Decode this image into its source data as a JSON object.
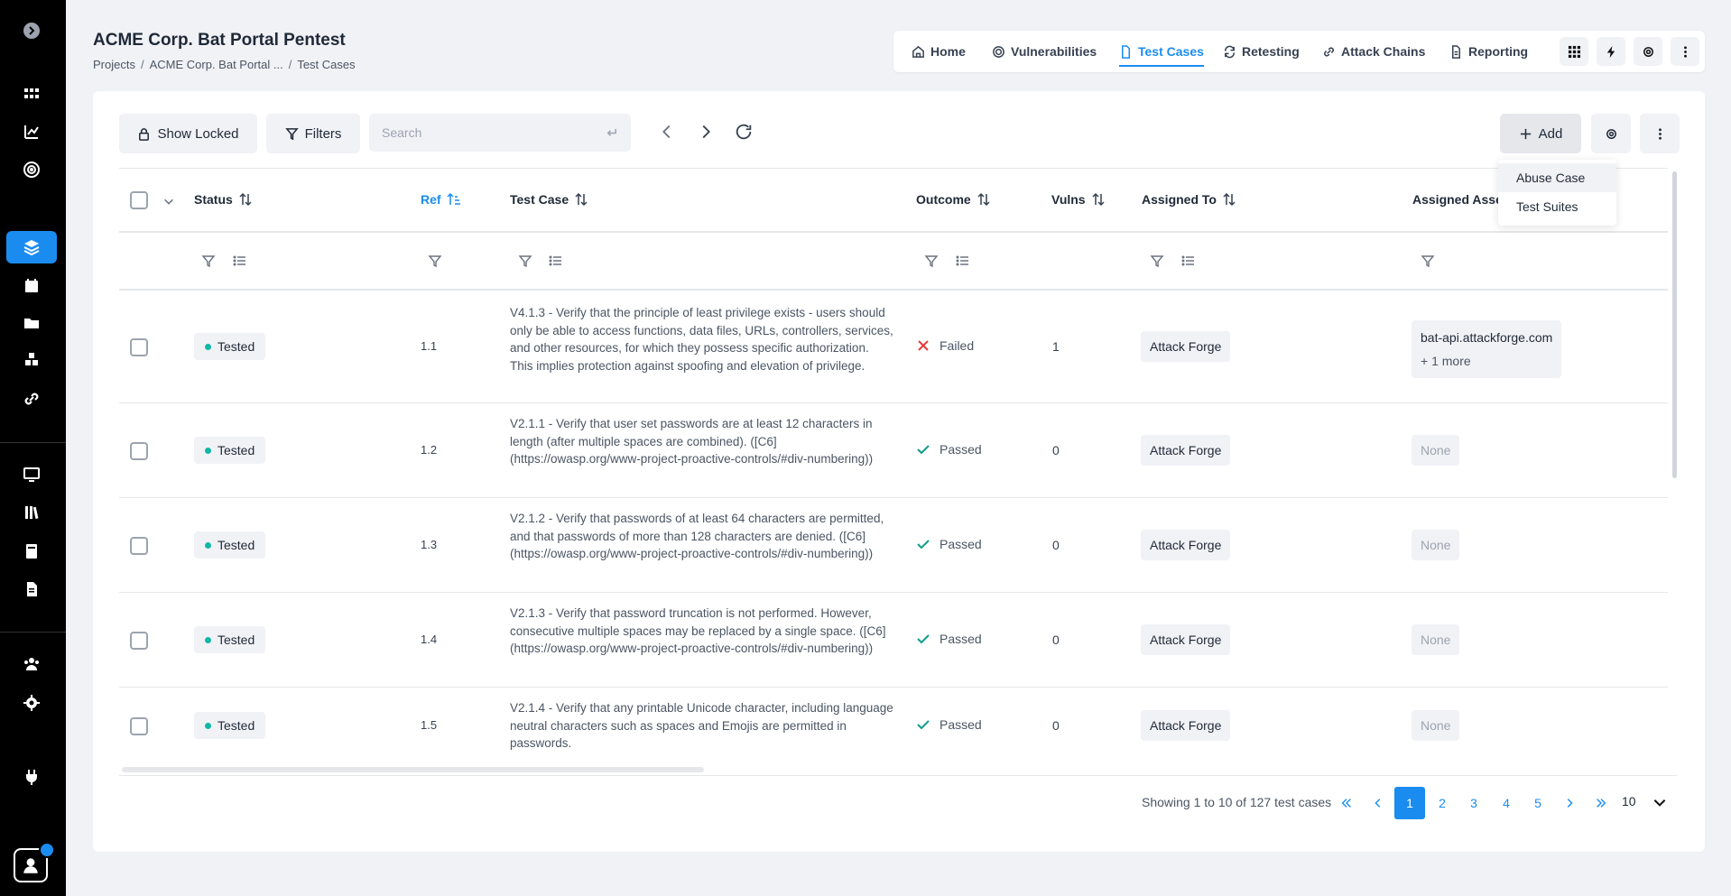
{
  "project": {
    "title": "ACME Corp. Bat Portal Pentest",
    "breadcrumb": [
      "Projects",
      "ACME Corp. Bat Portal ...",
      "Test Cases"
    ]
  },
  "nav": {
    "items": [
      {
        "label": "Home",
        "icon": "home-icon"
      },
      {
        "label": "Vulnerabilities",
        "icon": "target-icon"
      },
      {
        "label": "Test Cases",
        "icon": "document-icon",
        "active": true
      },
      {
        "label": "Retesting",
        "icon": "refresh-icon"
      },
      {
        "label": "Attack Chains",
        "icon": "link-icon"
      },
      {
        "label": "Reporting",
        "icon": "report-icon"
      }
    ]
  },
  "toolbar": {
    "show_locked": "Show Locked",
    "filters": "Filters",
    "search_placeholder": "Search",
    "add": "Add"
  },
  "add_menu": {
    "items": [
      "Abuse Case",
      "Test Suites"
    ]
  },
  "table": {
    "columns": [
      "Status",
      "Ref",
      "Test Case",
      "Outcome",
      "Vulns",
      "Assigned To",
      "Assigned Asse"
    ],
    "rows": [
      {
        "status": "Tested",
        "ref": "1.1",
        "test_case": "V4.1.3 - Verify that the principle of least privilege exists - users should only be able to access functions, data files, URLs, controllers, services, and other resources, for which they possess specific authorization. This implies protection against spoofing and elevation of privilege.",
        "outcome": "Failed",
        "vulns": "1",
        "assigned_to": "Attack Forge",
        "asset": "bat-api.attackforge.com",
        "asset_more": "+ 1 more"
      },
      {
        "status": "Tested",
        "ref": "1.2",
        "test_case": "V2.1.1 - Verify that user set passwords are at least 12 characters in length (after multiple spaces are combined). ([C6](https://owasp.org/www-project-proactive-controls/#div-numbering))",
        "outcome": "Passed",
        "vulns": "0",
        "assigned_to": "Attack Forge",
        "asset": "None"
      },
      {
        "status": "Tested",
        "ref": "1.3",
        "test_case": "V2.1.2 - Verify that passwords of at least 64 characters are permitted, and that passwords of more than 128 characters are denied. ([C6](https://owasp.org/www-project-proactive-controls/#div-numbering))",
        "outcome": "Passed",
        "vulns": "0",
        "assigned_to": "Attack Forge",
        "asset": "None"
      },
      {
        "status": "Tested",
        "ref": "1.4",
        "test_case": "V2.1.3 - Verify that password truncation is not performed. However, consecutive multiple spaces may be replaced by a single space. ([C6](https://owasp.org/www-project-proactive-controls/#div-numbering))",
        "outcome": "Passed",
        "vulns": "0",
        "assigned_to": "Attack Forge",
        "asset": "None"
      },
      {
        "status": "Tested",
        "ref": "1.5",
        "test_case": "V2.1.4 - Verify that any printable Unicode character, including language neutral characters such as spaces and Emojis are permitted in passwords.",
        "outcome": "Passed",
        "vulns": "0",
        "assigned_to": "Attack Forge",
        "asset": "None"
      }
    ]
  },
  "pagination": {
    "summary": "Showing 1 to 10 of 127 test cases",
    "pages": [
      "1",
      "2",
      "3",
      "4",
      "5"
    ],
    "current": "1",
    "page_size": "10"
  },
  "colors": {
    "accent": "#1a8cf0",
    "status_dot": "#10b8a6",
    "failed": "#e53935",
    "passed": "#0f9d8a"
  }
}
